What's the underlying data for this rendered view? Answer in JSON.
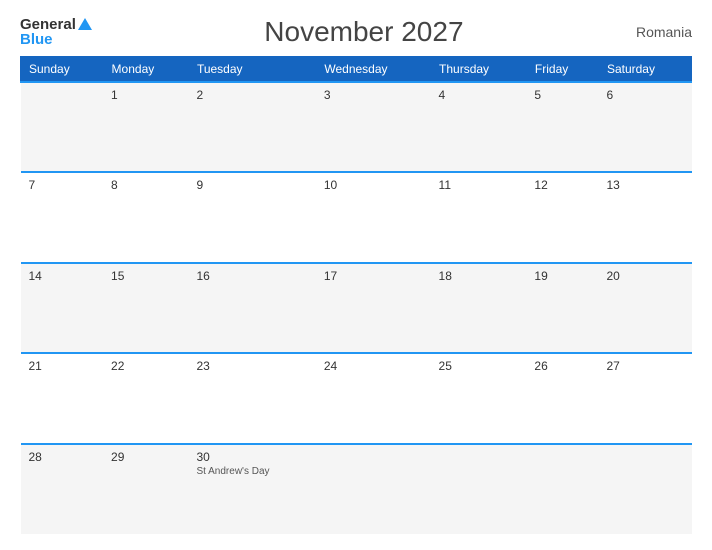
{
  "header": {
    "title": "November 2027",
    "country": "Romania",
    "logo": {
      "general": "General",
      "blue": "Blue"
    }
  },
  "weekdays": [
    "Sunday",
    "Monday",
    "Tuesday",
    "Wednesday",
    "Thursday",
    "Friday",
    "Saturday"
  ],
  "weeks": [
    [
      {
        "day": "",
        "holiday": ""
      },
      {
        "day": "1",
        "holiday": ""
      },
      {
        "day": "2",
        "holiday": ""
      },
      {
        "day": "3",
        "holiday": ""
      },
      {
        "day": "4",
        "holiday": ""
      },
      {
        "day": "5",
        "holiday": ""
      },
      {
        "day": "6",
        "holiday": ""
      }
    ],
    [
      {
        "day": "7",
        "holiday": ""
      },
      {
        "day": "8",
        "holiday": ""
      },
      {
        "day": "9",
        "holiday": ""
      },
      {
        "day": "10",
        "holiday": ""
      },
      {
        "day": "11",
        "holiday": ""
      },
      {
        "day": "12",
        "holiday": ""
      },
      {
        "day": "13",
        "holiday": ""
      }
    ],
    [
      {
        "day": "14",
        "holiday": ""
      },
      {
        "day": "15",
        "holiday": ""
      },
      {
        "day": "16",
        "holiday": ""
      },
      {
        "day": "17",
        "holiday": ""
      },
      {
        "day": "18",
        "holiday": ""
      },
      {
        "day": "19",
        "holiday": ""
      },
      {
        "day": "20",
        "holiday": ""
      }
    ],
    [
      {
        "day": "21",
        "holiday": ""
      },
      {
        "day": "22",
        "holiday": ""
      },
      {
        "day": "23",
        "holiday": ""
      },
      {
        "day": "24",
        "holiday": ""
      },
      {
        "day": "25",
        "holiday": ""
      },
      {
        "day": "26",
        "holiday": ""
      },
      {
        "day": "27",
        "holiday": ""
      }
    ],
    [
      {
        "day": "28",
        "holiday": ""
      },
      {
        "day": "29",
        "holiday": ""
      },
      {
        "day": "30",
        "holiday": "St Andrew's Day"
      },
      {
        "day": "",
        "holiday": ""
      },
      {
        "day": "",
        "holiday": ""
      },
      {
        "day": "",
        "holiday": ""
      },
      {
        "day": "",
        "holiday": ""
      }
    ]
  ],
  "colors": {
    "header_bg": "#1565C0",
    "accent": "#2196F3"
  }
}
